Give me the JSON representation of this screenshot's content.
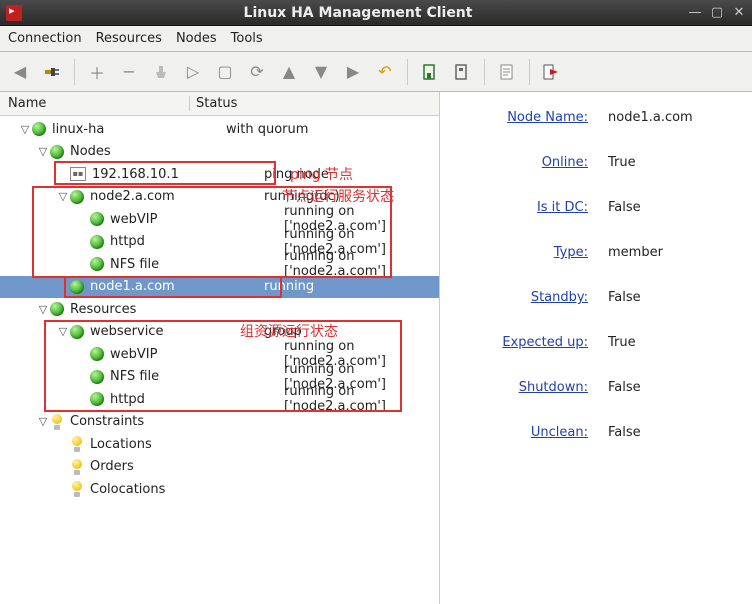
{
  "window": {
    "title": "Linux HA Management Client"
  },
  "menu": {
    "connection": "Connection",
    "resources": "Resources",
    "nodes": "Nodes",
    "tools": "Tools"
  },
  "columns": {
    "name": "Name",
    "status": "Status"
  },
  "tree": {
    "root": {
      "name": "linux-ha",
      "status": "with quorum"
    },
    "nodes_label": "Nodes",
    "ping_node": {
      "name": "192.168.10.1",
      "status": "ping node"
    },
    "node2": {
      "name": "node2.a.com",
      "status": "running(dc)"
    },
    "node2_res": [
      {
        "name": "webVIP",
        "status": "running on ['node2.a.com']"
      },
      {
        "name": "httpd",
        "status": "running on ['node2.a.com']"
      },
      {
        "name": "NFS file",
        "status": "running on ['node2.a.com']"
      }
    ],
    "node1": {
      "name": "node1.a.com",
      "status": "running"
    },
    "resources_label": "Resources",
    "webservice": {
      "name": "webservice",
      "status": "group"
    },
    "webservice_res": [
      {
        "name": "webVIP",
        "status": "running on ['node2.a.com']"
      },
      {
        "name": "NFS file",
        "status": "running on ['node2.a.com']"
      },
      {
        "name": "httpd",
        "status": "running on ['node2.a.com']"
      }
    ],
    "constraints_label": "Constraints",
    "constraints": [
      {
        "name": "Locations"
      },
      {
        "name": "Orders"
      },
      {
        "name": "Colocations"
      }
    ]
  },
  "annotations": {
    "ping": "ping 节点",
    "node_running": "节点运行服务状态",
    "group_running": "组资源运行状态"
  },
  "details": {
    "node_name": {
      "label": "Node Name:",
      "value": "node1.a.com"
    },
    "online": {
      "label": "Online:",
      "value": "True"
    },
    "is_dc": {
      "label": "Is it DC:",
      "value": "False"
    },
    "type": {
      "label": "Type:",
      "value": "member"
    },
    "standby": {
      "label": "Standby:",
      "value": "False"
    },
    "expected_up": {
      "label": "Expected up:",
      "value": "True"
    },
    "shutdown": {
      "label": "Shutdown:",
      "value": "False"
    },
    "unclean": {
      "label": "Unclean:",
      "value": "False"
    }
  }
}
